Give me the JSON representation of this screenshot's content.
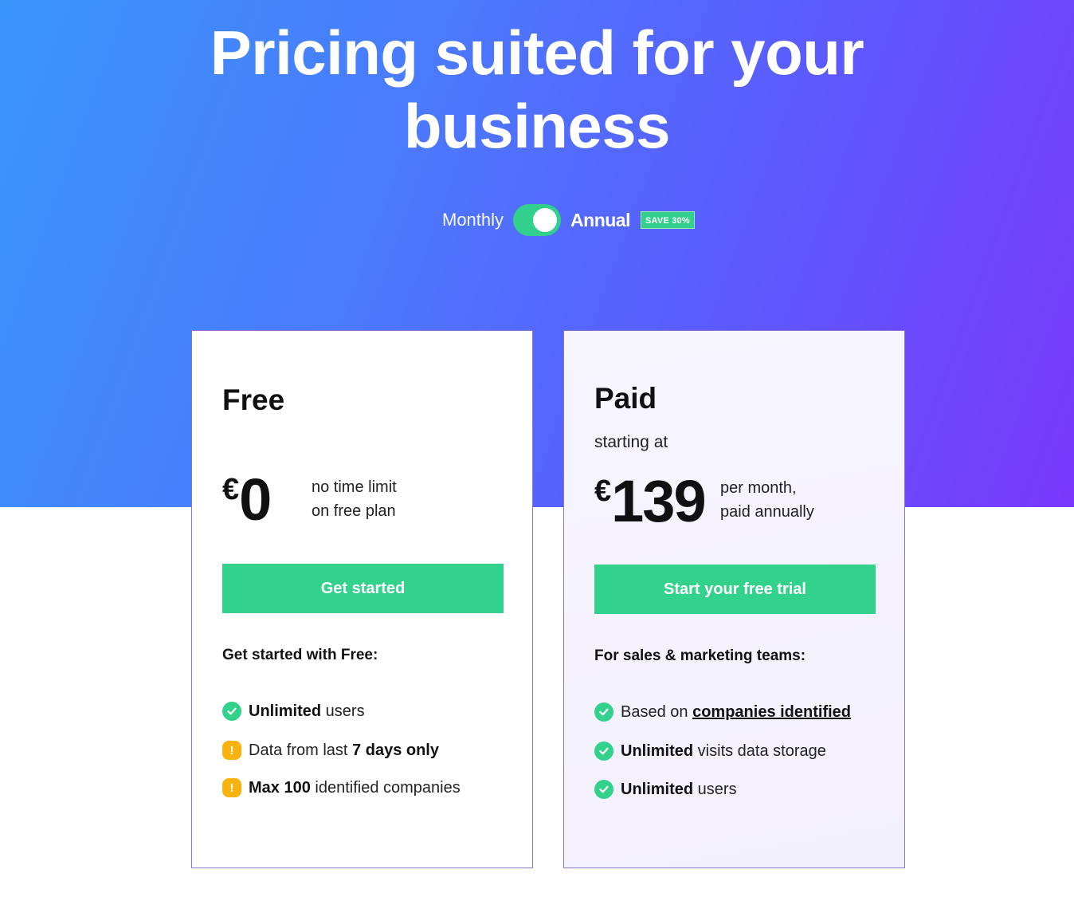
{
  "hero": {
    "title_line1": "Pricing suited for your",
    "title_line2": "business"
  },
  "billing": {
    "monthly_label": "Monthly",
    "annual_label": "Annual",
    "annual_selected": true,
    "save_badge": "SAVE 30%"
  },
  "plans": {
    "free": {
      "name": "Free",
      "currency": "€",
      "amount": "0",
      "note_line1": "no time limit",
      "note_line2": "on free plan",
      "cta": "Get started",
      "features_heading": "Get started with Free:",
      "features": [
        {
          "icon": "check-icon",
          "bold": "Unlimited",
          "text": " users"
        },
        {
          "icon": "warning-icon",
          "text": "Data from last ",
          "bold": "7 days only"
        },
        {
          "icon": "warning-icon",
          "bold": "Max 100",
          "text": " identified companies"
        }
      ]
    },
    "paid": {
      "name": "Paid",
      "starting_at": "starting at",
      "currency": "€",
      "amount": "139",
      "note_line1": "per month,",
      "note_line2": "paid annually",
      "cta": "Start your free trial",
      "features_heading": "For sales & marketing teams:",
      "features": [
        {
          "icon": "check-icon",
          "text": "Based on ",
          "link": "companies identified"
        },
        {
          "icon": "check-icon",
          "bold": "Unlimited",
          "text": " visits data storage"
        },
        {
          "icon": "check-icon",
          "bold": "Unlimited",
          "text": " users"
        }
      ]
    }
  },
  "colors": {
    "accent_green": "#33d28c",
    "warning_amber": "#f9b30e",
    "gradient_start": "#3a95fb",
    "gradient_end": "#7a38fc"
  }
}
